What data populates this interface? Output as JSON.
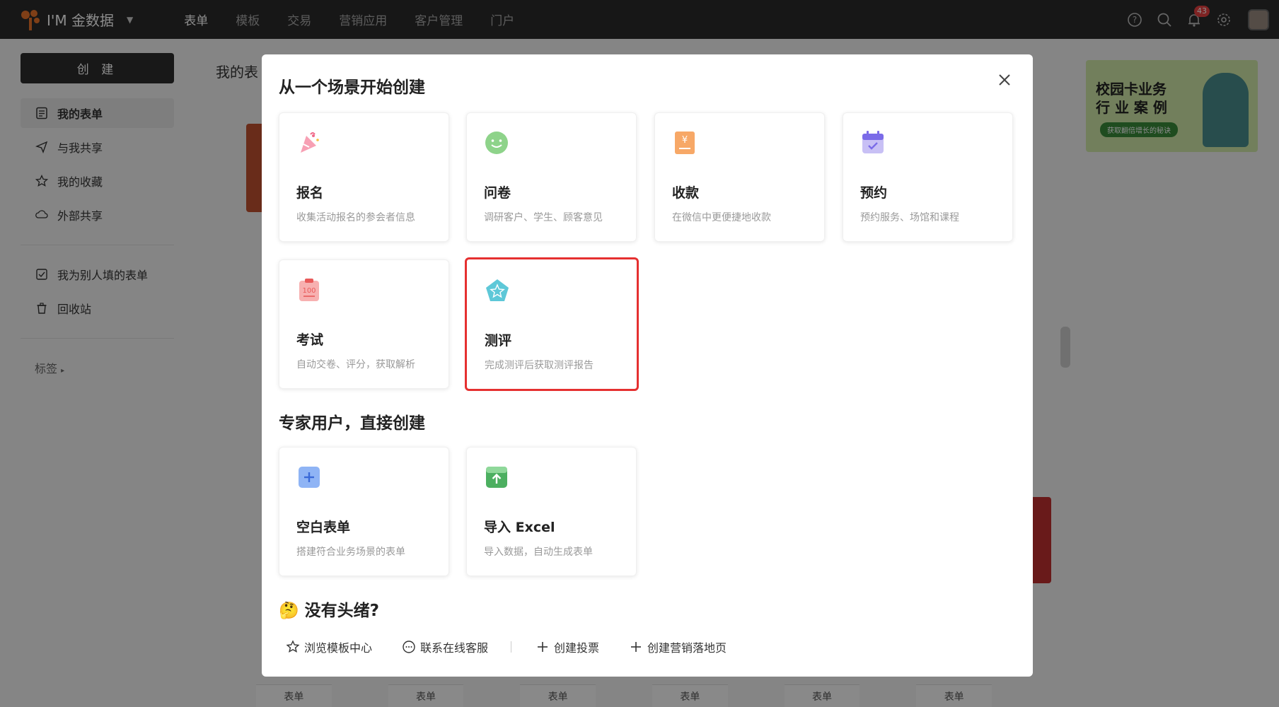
{
  "app": {
    "name": "I'M 金数据"
  },
  "nav": {
    "items": [
      "表单",
      "模板",
      "交易",
      "营销应用",
      "客户管理",
      "门户"
    ],
    "active_index": 0
  },
  "notifications": {
    "count": "43"
  },
  "sidebar": {
    "create_label": "创 建",
    "items": [
      {
        "label": "我的表单",
        "icon": "form-icon"
      },
      {
        "label": "与我共享",
        "icon": "send-icon"
      },
      {
        "label": "我的收藏",
        "icon": "star-icon"
      },
      {
        "label": "外部共享",
        "icon": "cloud-share-icon"
      },
      {
        "label": "我为别人填的表单",
        "icon": "checkbox-icon"
      },
      {
        "label": "回收站",
        "icon": "trash-icon"
      }
    ],
    "tags_label": "标签"
  },
  "background": {
    "title": "我的表",
    "banner": {
      "line1": "校园卡业务",
      "line2": "行 业 案 例",
      "pill": "获取翻倍增长的秘诀"
    },
    "strip_labels": [
      "表单",
      "表单",
      "表单",
      "表单",
      "表单",
      "表单"
    ]
  },
  "modal": {
    "section1_title": "从一个场景开始创建",
    "section2_title": "专家用户，直接创建",
    "section3_title": "🤔 没有头绪?",
    "scene_cards": [
      {
        "title": "报名",
        "desc": "收集活动报名的参会者信息",
        "icon": "party-popper-icon",
        "color": "#f06a8a"
      },
      {
        "title": "问卷",
        "desc": "调研客户、学生、顾客意见",
        "icon": "smiley-icon",
        "color": "#8ed38a"
      },
      {
        "title": "收款",
        "desc": "在微信中更便捷地收款",
        "icon": "yen-receipt-icon",
        "color": "#f7a867"
      },
      {
        "title": "预约",
        "desc": "预约服务、场馆和课程",
        "icon": "calendar-check-icon",
        "color": "#7b6be8"
      },
      {
        "title": "考试",
        "desc": "自动交卷、评分，获取解析",
        "icon": "exam-score-icon",
        "color": "#f28a8a"
      },
      {
        "title": "测评",
        "desc": "完成测评后获取测评报告",
        "icon": "pentagon-star-icon",
        "color": "#5ec8d8"
      }
    ],
    "expert_cards": [
      {
        "title": "空白表单",
        "desc": "搭建符合业务场景的表单",
        "icon": "plus-square-icon",
        "color": "#8fb4f5"
      },
      {
        "title": "导入 Excel",
        "desc": "导入数据，自动生成表单",
        "icon": "upload-icon",
        "color": "#4caf60"
      }
    ],
    "bottom_links": [
      {
        "label": "浏览模板中心",
        "icon": "template-star-icon"
      },
      {
        "label": "联系在线客服",
        "icon": "chat-icon"
      },
      {
        "label": "创建投票",
        "icon": "plus-icon"
      },
      {
        "label": "创建营销落地页",
        "icon": "plus-icon"
      }
    ]
  }
}
